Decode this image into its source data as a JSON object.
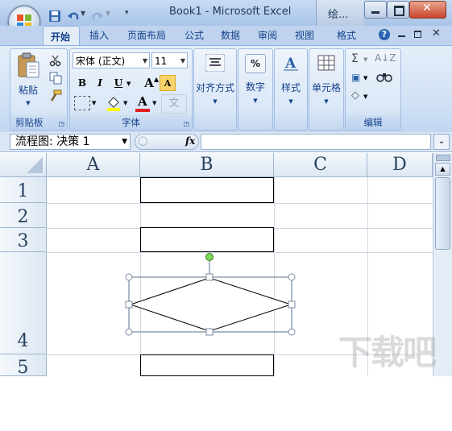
{
  "titlebar": {
    "doc_title": "Book1 - Microsoft Excel",
    "contextual_tab": "绘..."
  },
  "tabs": [
    {
      "label": "开始",
      "active": true
    },
    {
      "label": "插入"
    },
    {
      "label": "页面布局"
    },
    {
      "label": "公式"
    },
    {
      "label": "数据"
    },
    {
      "label": "审阅"
    },
    {
      "label": "视图"
    },
    {
      "label": "格式"
    }
  ],
  "ribbon": {
    "clipboard": {
      "paste_label": "粘贴",
      "group_label": "剪贴板"
    },
    "font": {
      "font_name": "宋体 (正文)",
      "font_size": "11",
      "group_label": "字体",
      "bold": "B",
      "italic": "I",
      "underline": "U",
      "grow": "A",
      "shrink": "A",
      "color_letter": "A",
      "phonetic": "文"
    },
    "alignment": {
      "label": "对齐方式"
    },
    "number": {
      "label": "数字",
      "icon_text": "%"
    },
    "styles": {
      "label": "样式"
    },
    "cells": {
      "label": "单元格"
    },
    "editing": {
      "group_label": "编辑"
    }
  },
  "formula_bar": {
    "name_box": "流程图: 决策 1",
    "fx": "fx",
    "formula": ""
  },
  "sheet": {
    "columns": [
      "A",
      "B",
      "C",
      "D"
    ],
    "rows": [
      "1",
      "2",
      "3",
      "4",
      "5"
    ]
  },
  "watermark": "下载吧"
}
